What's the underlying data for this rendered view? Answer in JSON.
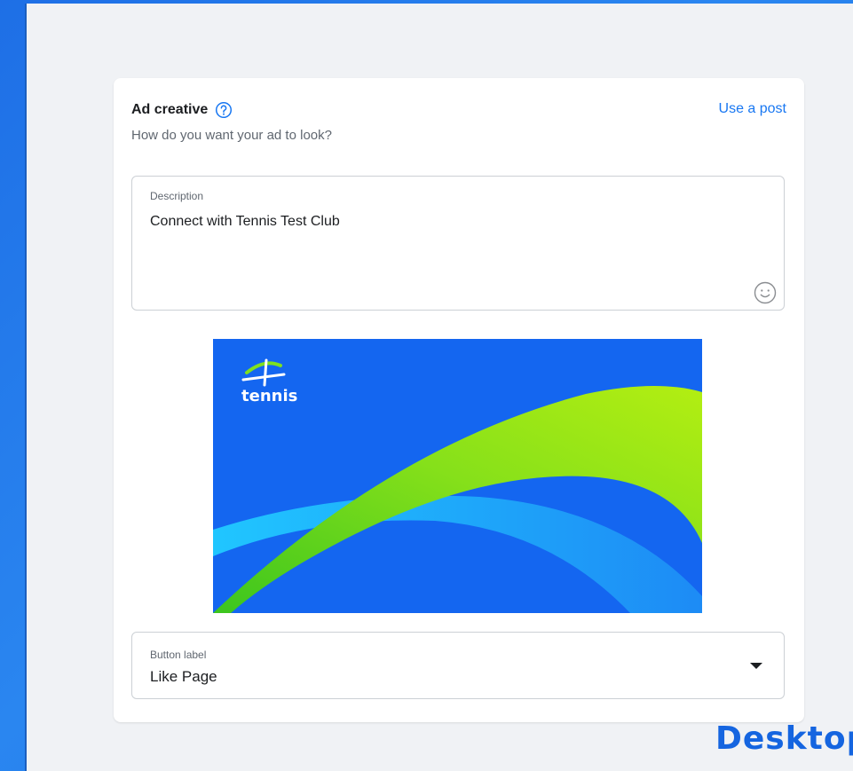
{
  "card": {
    "title": "Ad creative",
    "subtitle": "How do you want your ad to look?",
    "use_post_link": "Use a post"
  },
  "description": {
    "label": "Description",
    "value": "Connect with Tennis Test Club"
  },
  "preview": {
    "logo_text": "tennis",
    "colors": {
      "background": "#1466f0",
      "green": "#7fe01f",
      "cyan": "#1fc2ff"
    }
  },
  "button_field": {
    "label": "Button label",
    "value": "Like Page"
  },
  "corner_tag": "Desktop",
  "icons": {
    "help": "question-circle-icon",
    "emoji": "smiley-icon",
    "dropdown": "caret-down-icon"
  },
  "colors": {
    "accent": "#1877f2",
    "page_background": "#2a86f0"
  }
}
